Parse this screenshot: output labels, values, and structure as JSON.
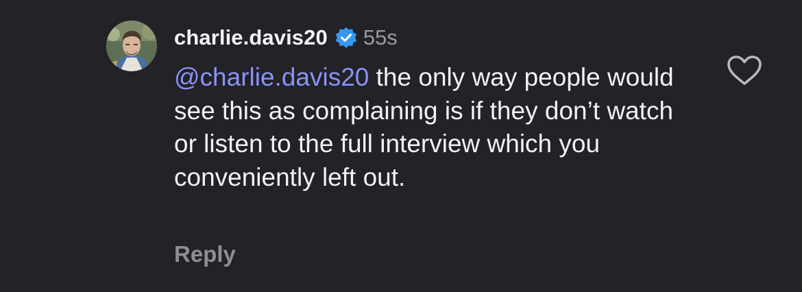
{
  "comment": {
    "username": "charlie.davis20",
    "verified_icon": "verified-badge-icon",
    "timestamp": "55s",
    "mention": "@charlie.davis20",
    "text": " the only way people would see this as complaining is if they don’t watch or listen to the full interview which you conveniently left out.",
    "reply_label": "Reply",
    "like_icon": "heart-outline-icon"
  },
  "colors": {
    "background": "#222227",
    "mention": "#8a93f5",
    "verified": "#3897f0",
    "secondary_text": "#8e8e96"
  }
}
